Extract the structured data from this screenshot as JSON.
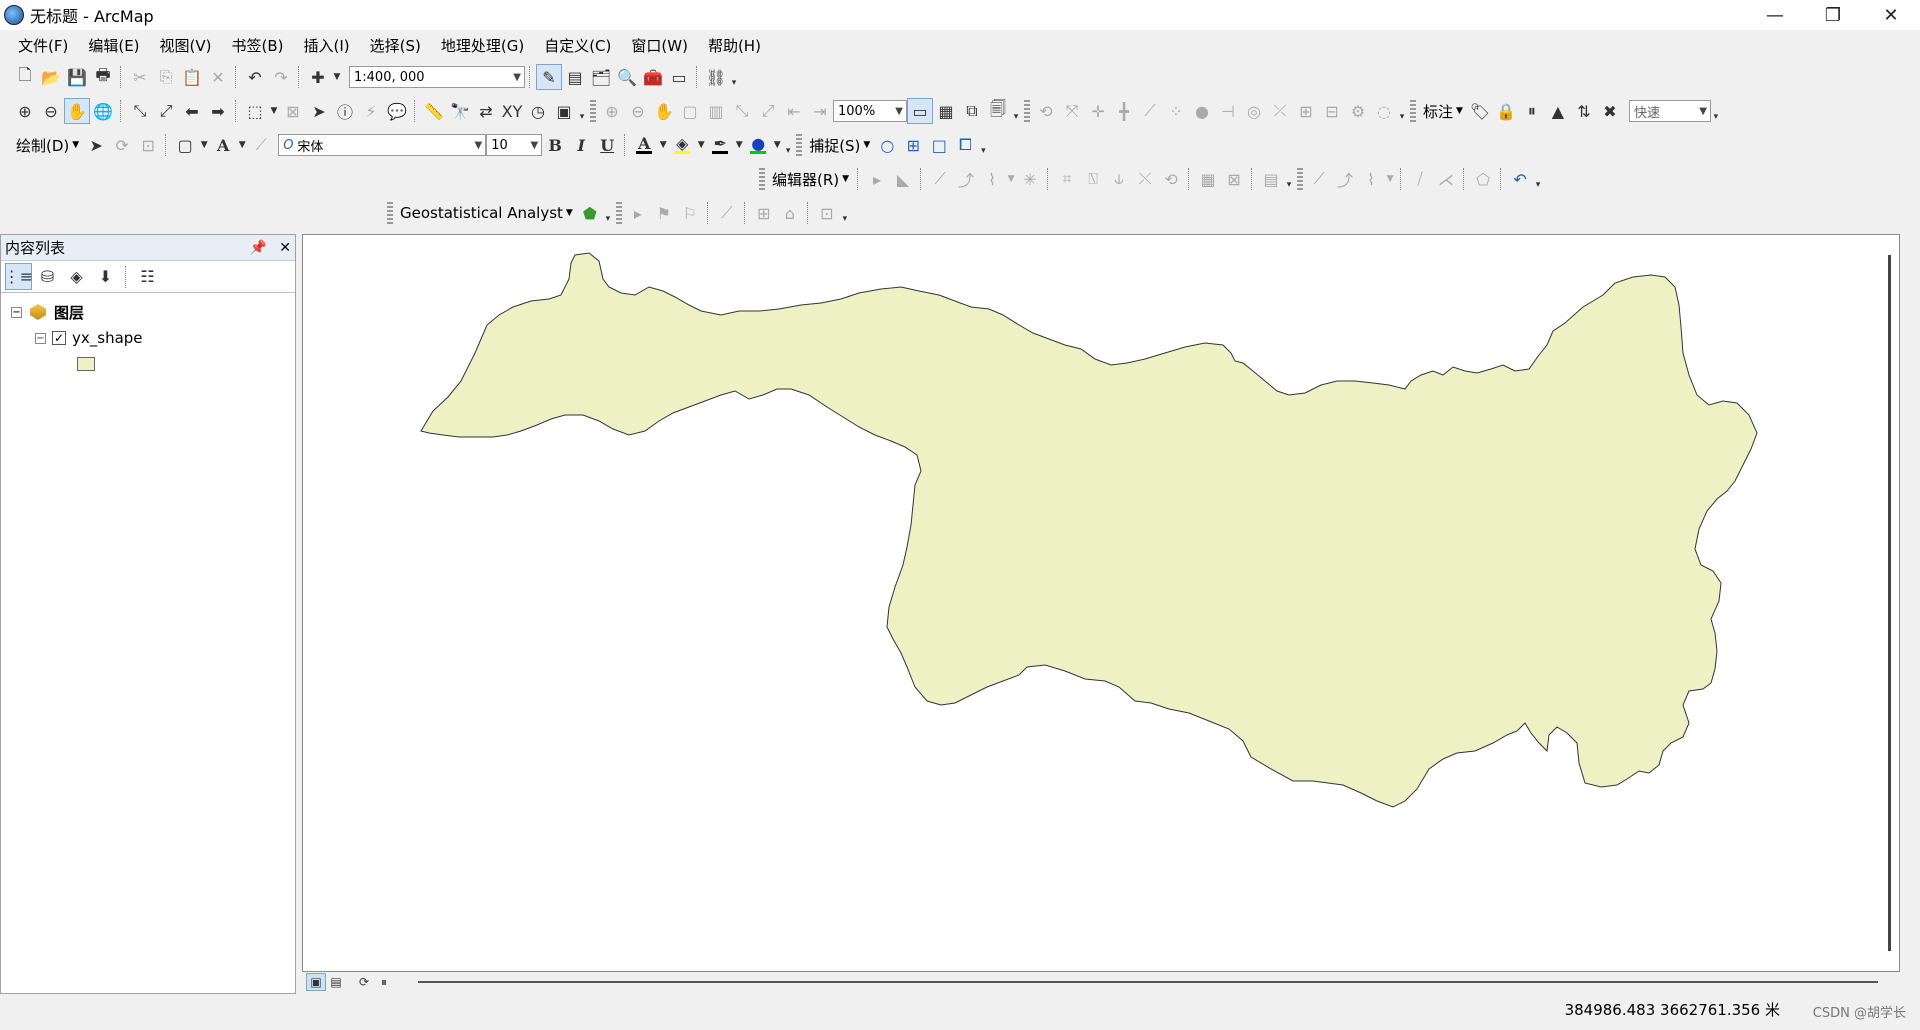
{
  "window": {
    "title": "无标题 - ArcMap",
    "minimize": "—",
    "restore": "❐",
    "close": "✕"
  },
  "menu": [
    "文件(F)",
    "编辑(E)",
    "视图(V)",
    "书签(B)",
    "插入(I)",
    "选择(S)",
    "地理处理(G)",
    "自定义(C)",
    "窗口(W)",
    "帮助(H)"
  ],
  "standard_toolbar": {
    "scale": "1:400, 000"
  },
  "tools_toolbar": {
    "zoom_level": "100%",
    "labeling_label": "标注",
    "quick_label": "快速"
  },
  "draw_toolbar": {
    "draw_label": "绘制(D)",
    "font_name": "宋体",
    "font_size": "10",
    "bold": "B",
    "italic": "I",
    "underline": "U",
    "text_tool": "A",
    "snapping_label": "捕捉(S)",
    "font_color": "#000000",
    "fill_color": "#ffff00",
    "line_color": "#000000",
    "marker_color": "#00cc00"
  },
  "editor_toolbar": {
    "editor_label": "编辑器(R)"
  },
  "geostat_toolbar": {
    "label": "Geostatistical Analyst"
  },
  "toc": {
    "title": "内容列表",
    "pin": "📌",
    "close": "✕",
    "root_label": "图层",
    "layer_name": "yx_shape",
    "layer_checked": "✓",
    "symbol_color": "#eef1c4"
  },
  "map": {
    "fill_color": "#eef1c4",
    "outline_color": "#333333"
  },
  "status": {
    "coordinates": "384986.483  3662761.356 米"
  },
  "watermark": "CSDN @胡学长"
}
